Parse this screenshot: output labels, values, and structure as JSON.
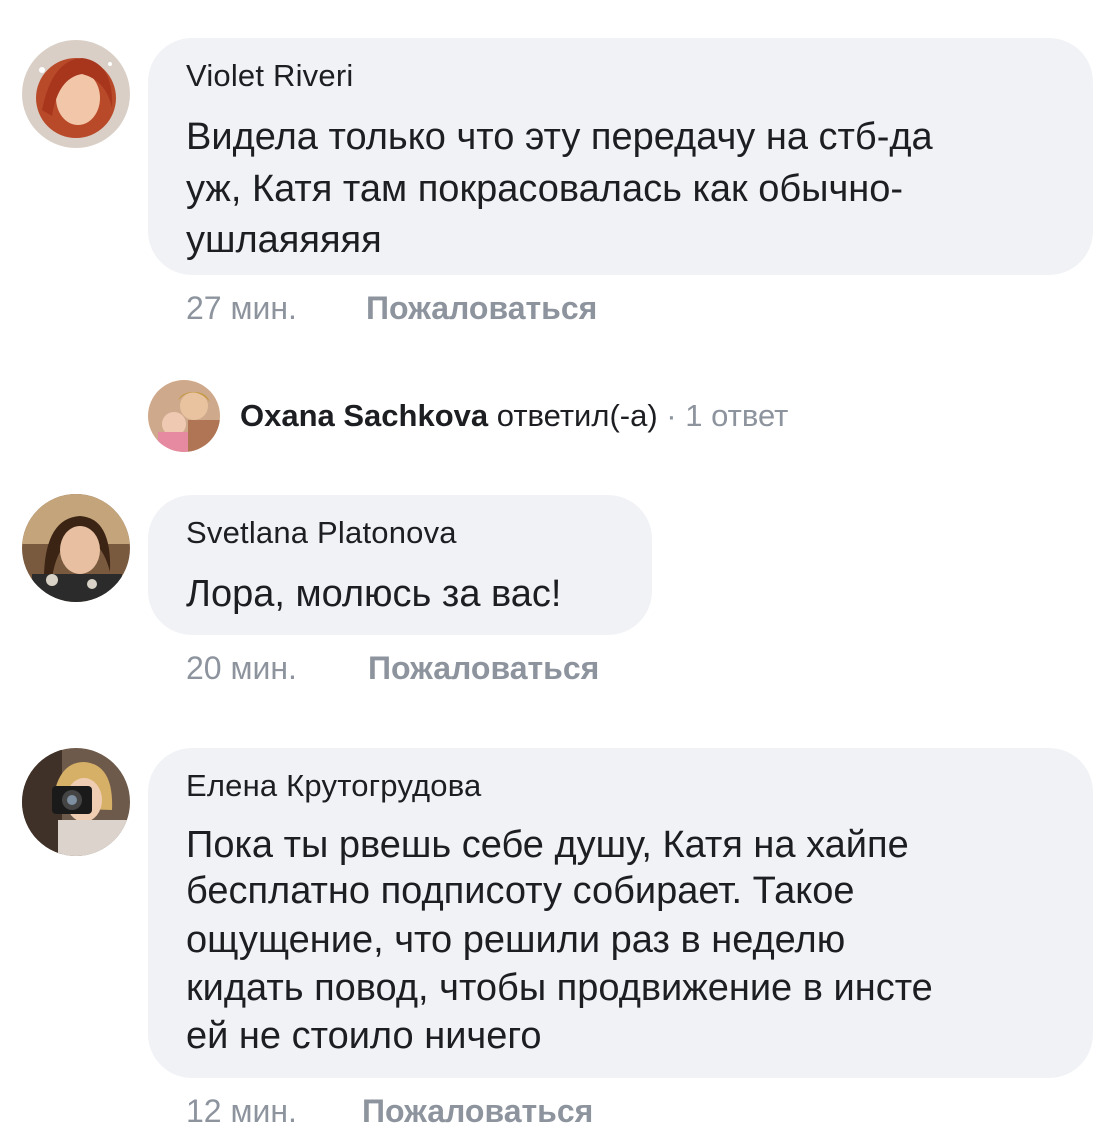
{
  "comments": [
    {
      "author": "Violet Riveri",
      "lines": [
        "Видела только что эту передачу на стб-да",
        "уж, Катя там покрасовалась как обычно-",
        "ушлаяяяяя"
      ],
      "time": "27 мин.",
      "report_label": "Пожаловаться"
    },
    {
      "author": "Svetlana Platonova",
      "lines": [
        "Лора, молюсь за вас!"
      ],
      "time": "20 мин.",
      "report_label": "Пожаловаться"
    },
    {
      "author": "Елена Крутогрудова",
      "lines": [
        "Пока ты рвешь себе душу, Катя на хайпе",
        "бесплатно подписоту собирает. Такое",
        "ощущение, что решили раз в неделю",
        "кидать повод, чтобы продвижение в инсте",
        "ей не стоило ничего"
      ],
      "time": "12 мин.",
      "report_label": "Пожаловаться"
    }
  ],
  "reply_summary": {
    "name": "Oxana Sachkova",
    "action": " ответил(-а) ",
    "separator": "·",
    "count": " 1 ответ"
  },
  "colors": {
    "bubble": "#f0f2f5",
    "text": "#1c1e21",
    "meta": "#8d949e"
  }
}
